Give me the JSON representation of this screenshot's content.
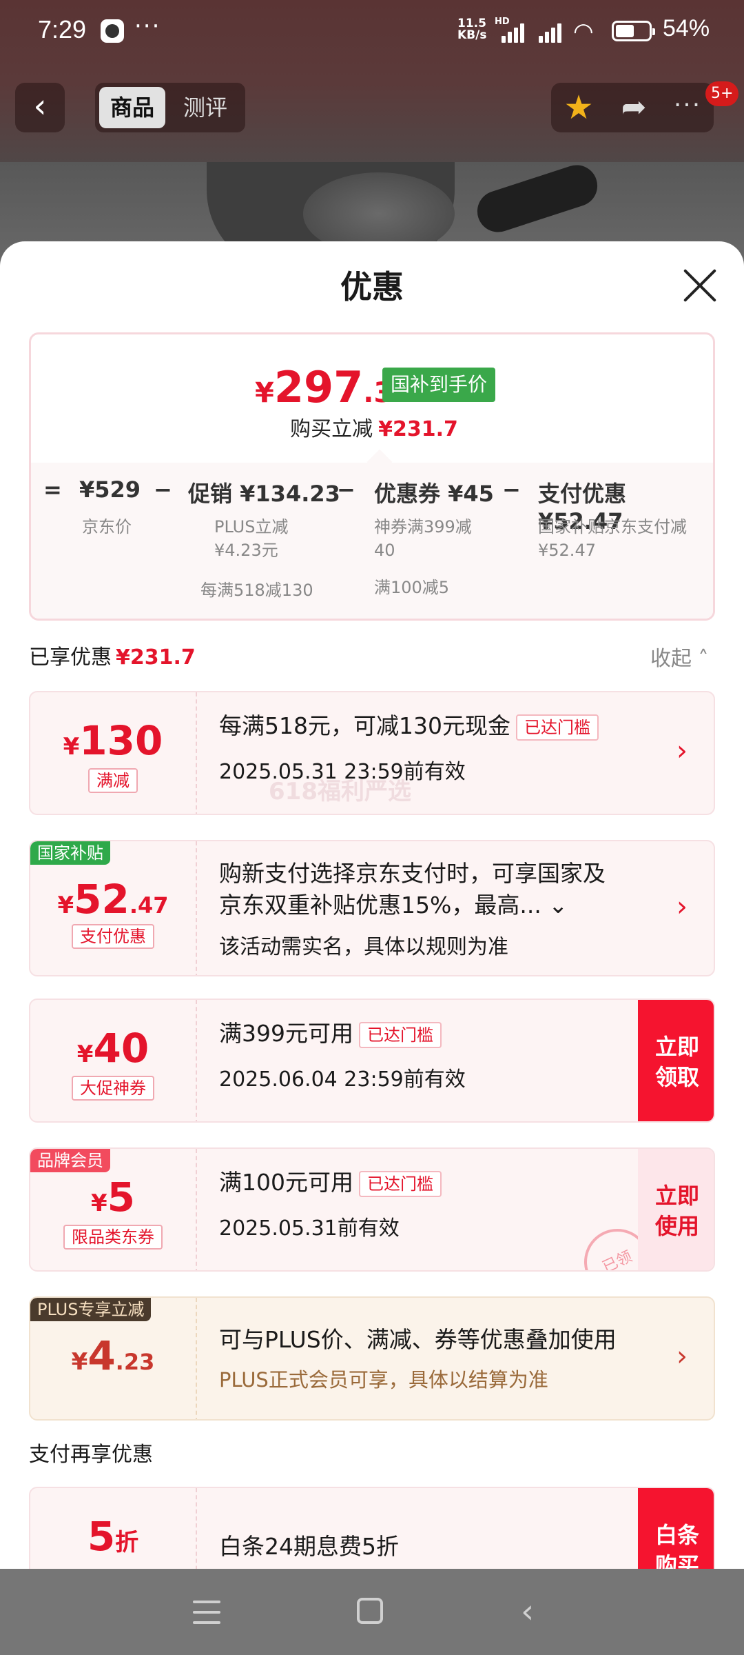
{
  "status_bar": {
    "time": "7:29",
    "dots": "···",
    "speed_value": "11.5",
    "speed_unit": "KB/s",
    "hd": "HD",
    "battery_pct": "54%"
  },
  "top_nav": {
    "back_icon": "‹",
    "tabs": [
      "商品",
      "测评"
    ],
    "badge": "5+"
  },
  "sheet": {
    "title": "优惠"
  },
  "summary": {
    "price_symbol": "¥",
    "price_int": "297",
    "price_dec": ".3",
    "price_tag": "国补到手价",
    "reduce_label": "购买立减",
    "reduce_amount": "¥231.7",
    "eq": "=",
    "minus": "−",
    "jd_price": "¥529",
    "jd_label": "京东价",
    "promo": "促销 ¥134.23",
    "promo_sub1": "PLUS立减",
    "promo_sub2": "¥4.23元",
    "promo_sub3": "每满518减130",
    "coupon": "优惠券 ¥45",
    "coupon_sub1": "神券满399减",
    "coupon_sub2": "40",
    "coupon_sub3": "满100减5",
    "pay": "支付优惠 ¥52.47",
    "pay_sub1": "国家补贴京东支付减",
    "pay_sub2": "¥52.47"
  },
  "enjoyed": {
    "label": "已享优惠",
    "amount": "¥231.7",
    "collapse": "收起"
  },
  "cards": [
    {
      "sym": "¥",
      "num": "130",
      "dec": "",
      "chip": "满减",
      "line1": "每满518元，可减130元现金",
      "tag": "已达门槛",
      "line2": "2025.05.31 23:59前有效"
    },
    {
      "corner": "国家补贴",
      "sym": "¥",
      "num": "52",
      "dec": ".47",
      "chip": "支付优惠",
      "line1": "购新支付选择京东支付时，可享国家及",
      "line1b": "京东双重补贴优惠15%，最高...",
      "line2": "该活动需实名，具体以规则为准"
    },
    {
      "sym": "¥",
      "num": "40",
      "dec": "",
      "chip": "大促神券",
      "line1": "满399元可用",
      "tag": "已达门槛",
      "line2": "2025.06.04 23:59前有效",
      "action1": "立即",
      "action2": "领取"
    },
    {
      "corner": "品牌会员",
      "sym": "¥",
      "num": "5",
      "dec": "",
      "chip": "限品类东券",
      "line1": "满100元可用",
      "tag": "已达门槛",
      "line2": "2025.05.31前有效",
      "action1": "立即",
      "action2": "使用",
      "stamp": "已领"
    },
    {
      "corner": "PLUS专享立减",
      "sym": "¥",
      "num": "4",
      "dec": ".23",
      "line1": "可与PLUS价、满减、券等优惠叠加使用",
      "line2": "PLUS正式会员可享，具体以结算为准"
    }
  ],
  "watermark": "618福利严选",
  "pay_more": {
    "title": "支付再享优惠",
    "num": "5",
    "unit": "折",
    "line1": "白条24期息费5折",
    "action1": "白条",
    "action2": "购买"
  },
  "colors": {
    "accent": "#e4142b",
    "green_tag": "#3aa84a",
    "action_red": "#f5142f"
  }
}
